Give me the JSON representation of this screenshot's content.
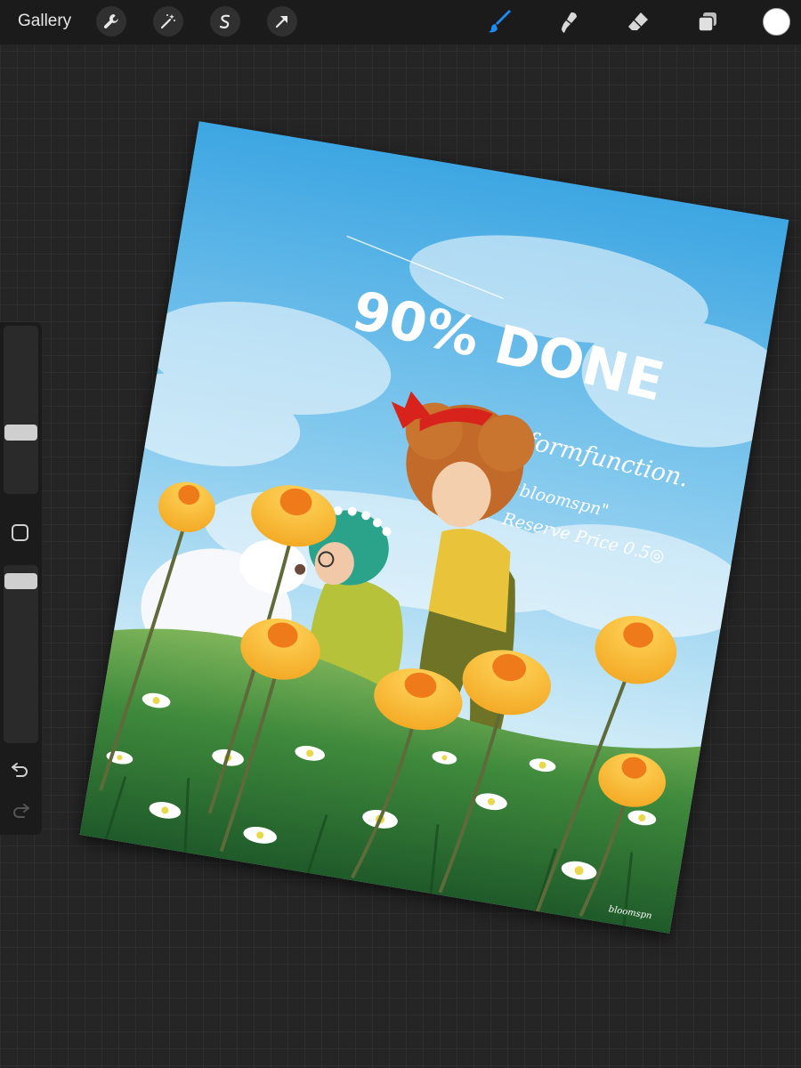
{
  "topbar": {
    "gallery_label": "Gallery",
    "left_tools": [
      "wrench-icon",
      "magic-wand-icon",
      "selection-icon",
      "transform-arrow-icon"
    ],
    "right_tools": [
      "brush-icon",
      "smudge-icon",
      "eraser-icon",
      "layers-icon"
    ],
    "active_tool": "brush-icon",
    "accent_color": "#1d8bf1",
    "current_color": "#ffffff"
  },
  "sidebar": {
    "brush_size_level": 0.35,
    "opacity_level": 0.95,
    "undo_icon": "undo-icon",
    "redo_icon": "redo-icon"
  },
  "artwork": {
    "headline": "90% DONE",
    "handle": "@formfunction.",
    "title_quote": "\"bloomspn\"",
    "reserve": "Reserve Price 0.5◎",
    "signature": "bloomspn"
  }
}
